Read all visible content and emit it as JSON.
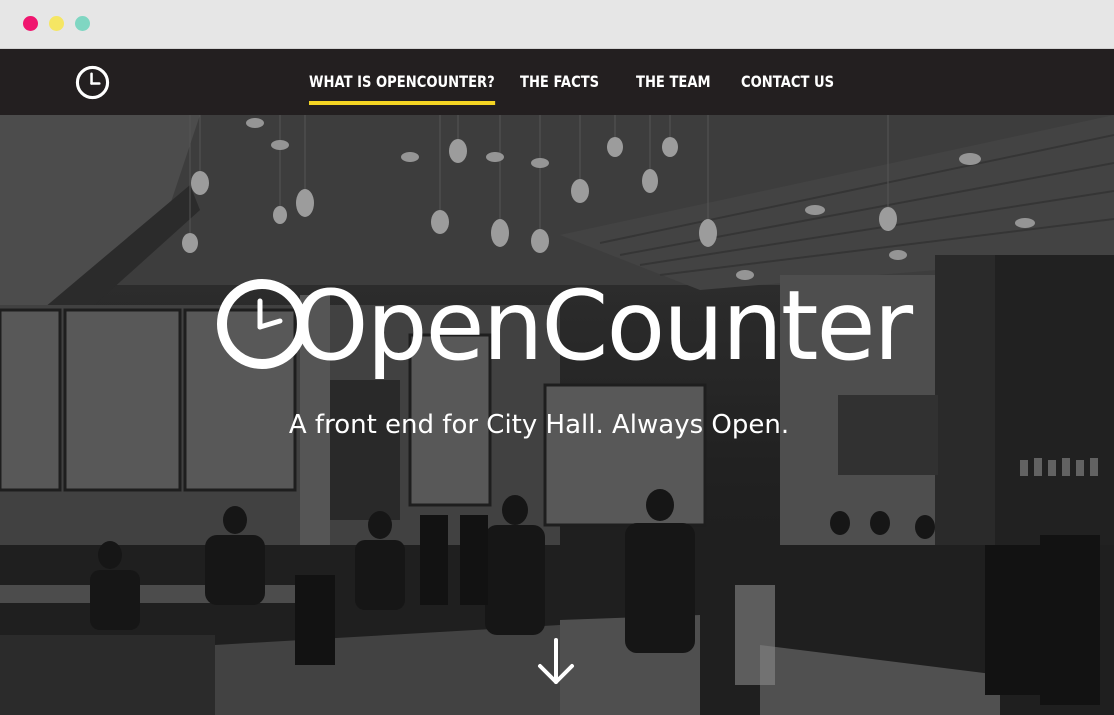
{
  "window": {
    "controls": [
      {
        "name": "close",
        "color": "#f0166f"
      },
      {
        "name": "minimize",
        "color": "#f5e663"
      },
      {
        "name": "zoom",
        "color": "#7fd6c2"
      }
    ]
  },
  "navbar": {
    "logo_icon": "clock-icon",
    "items": [
      {
        "label": "WHAT IS OPENCOUNTER?",
        "active": true
      },
      {
        "label": "THE FACTS",
        "active": false
      },
      {
        "label": "THE TEAM",
        "active": false
      },
      {
        "label": "CONTACT US",
        "active": false
      }
    ],
    "active_underline_color": "#f4d423",
    "background": "#231f20"
  },
  "hero": {
    "brand": "OpenCounter",
    "brand_icon": "clock-icon",
    "tagline": "A front end for City Hall. Always Open.",
    "scroll_icon": "arrow-down-icon",
    "background_image": "grayscale-cafe-interior-photo"
  }
}
